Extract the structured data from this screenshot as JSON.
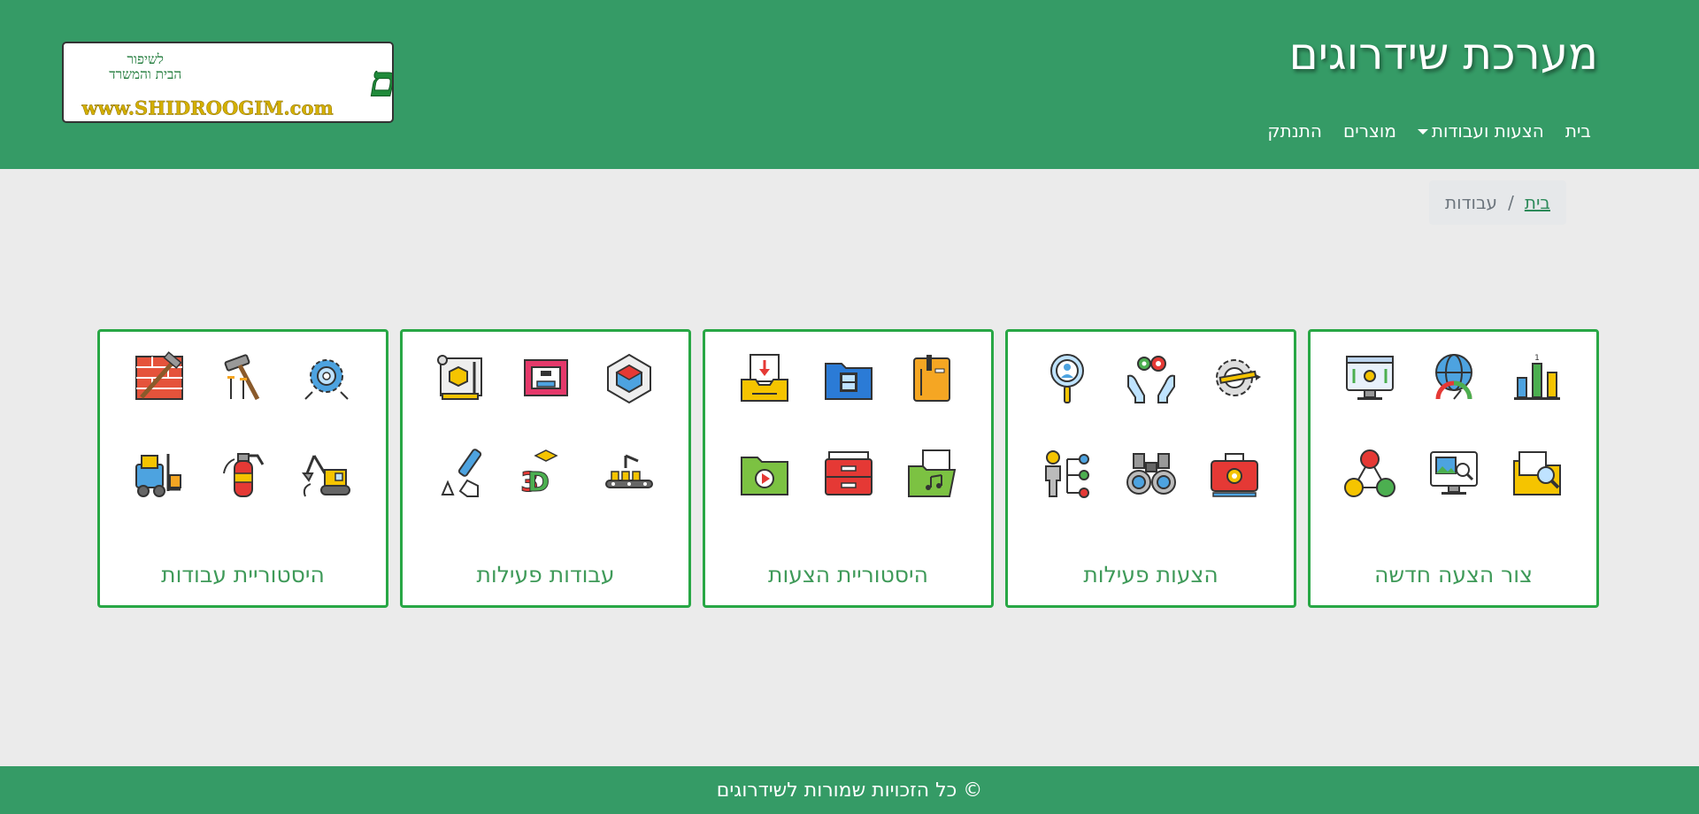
{
  "header": {
    "site_title": "מערכת שידרוגים",
    "nav": [
      {
        "label": "בית"
      },
      {
        "label": "הצעות ועבודות"
      },
      {
        "label": "מוצרים"
      },
      {
        "label": "התנתק"
      }
    ],
    "logo": {
      "main": "שידרוגים",
      "tagline1": "לשיפור",
      "tagline2": "הבית והמשרד",
      "url": "www.SHIDROOGIM.com"
    }
  },
  "breadcrumb": {
    "home": "בית",
    "separator": "/",
    "current": "עבודות"
  },
  "cards": [
    {
      "title": "צור הצעה חדשה",
      "icons": [
        "bar-chart-icon",
        "globe-gauge-icon",
        "monitor-settings-icon",
        "folder-search-icon",
        "image-search-monitor-icon",
        "network-links-icon"
      ]
    },
    {
      "title": "הצעות פעילות",
      "icons": [
        "gear-pencil-icon",
        "hands-gears-icon",
        "search-person-icon",
        "toolbox-icon",
        "binoculars-icon",
        "person-hierarchy-icon"
      ]
    },
    {
      "title": "היסטוריית הצעות",
      "icons": [
        "orange-folder-icon",
        "video-folder-icon",
        "inbox-download-icon",
        "music-folder-icon",
        "red-drawer-icon",
        "play-folder-icon"
      ]
    },
    {
      "title": "עבודות פעילות",
      "icons": [
        "cube-house-icon",
        "3d-printer-icon",
        "blueprint-icon",
        "conveyor-icon",
        "3d-text-icon",
        "3d-pen-icon"
      ]
    },
    {
      "title": "היסטוריית עבודות",
      "icons": [
        "gears-icon",
        "hammer-nails-icon",
        "brick-hammer-icon",
        "excavator-icon",
        "fire-extinguisher-icon",
        "forklift-icon"
      ]
    }
  ],
  "footer": {
    "text": "© כל הזכויות שמורות לשידרוגים"
  },
  "colors": {
    "brand_green": "#359b66",
    "card_border": "#28a745",
    "card_title": "#3f9a59",
    "page_bg": "#ebebeb"
  }
}
